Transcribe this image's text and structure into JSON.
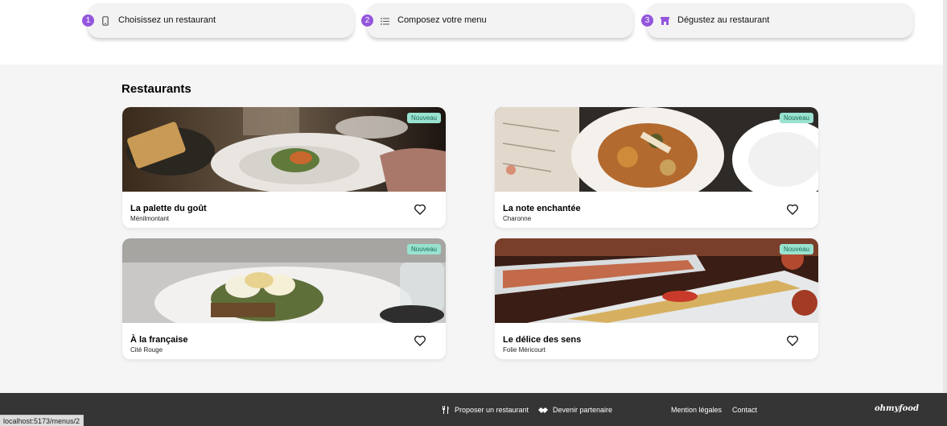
{
  "steps": [
    {
      "number": "1",
      "label": "Choisissez un restaurant",
      "icon": "phone-icon"
    },
    {
      "number": "2",
      "label": "Composez votre menu",
      "icon": "list-icon"
    },
    {
      "number": "3",
      "label": "Dégustez au restaurant",
      "icon": "store-icon"
    }
  ],
  "section": {
    "title": "Restaurants"
  },
  "restaurants": [
    {
      "name": "La palette du goût",
      "location": "Ménilmontant",
      "badge": "Nouveau"
    },
    {
      "name": "La note enchantée",
      "location": "Charonne",
      "badge": "Nouveau"
    },
    {
      "name": "À la française",
      "location": "Cité Rouge",
      "badge": "Nouveau"
    },
    {
      "name": "Le délice des sens",
      "location": "Folie Méricourt",
      "badge": "Nouveau"
    }
  ],
  "footer": {
    "propose": "Proposer un restaurant",
    "partner": "Devenir partenaire",
    "legal": "Mention légales",
    "contact": "Contact",
    "logo": "ohmyfood"
  },
  "status_url": "localhost:5173/menus/2",
  "colors": {
    "accent": "#9356dc",
    "badge_bg": "#99e2d0",
    "footer_bg": "#353535"
  }
}
